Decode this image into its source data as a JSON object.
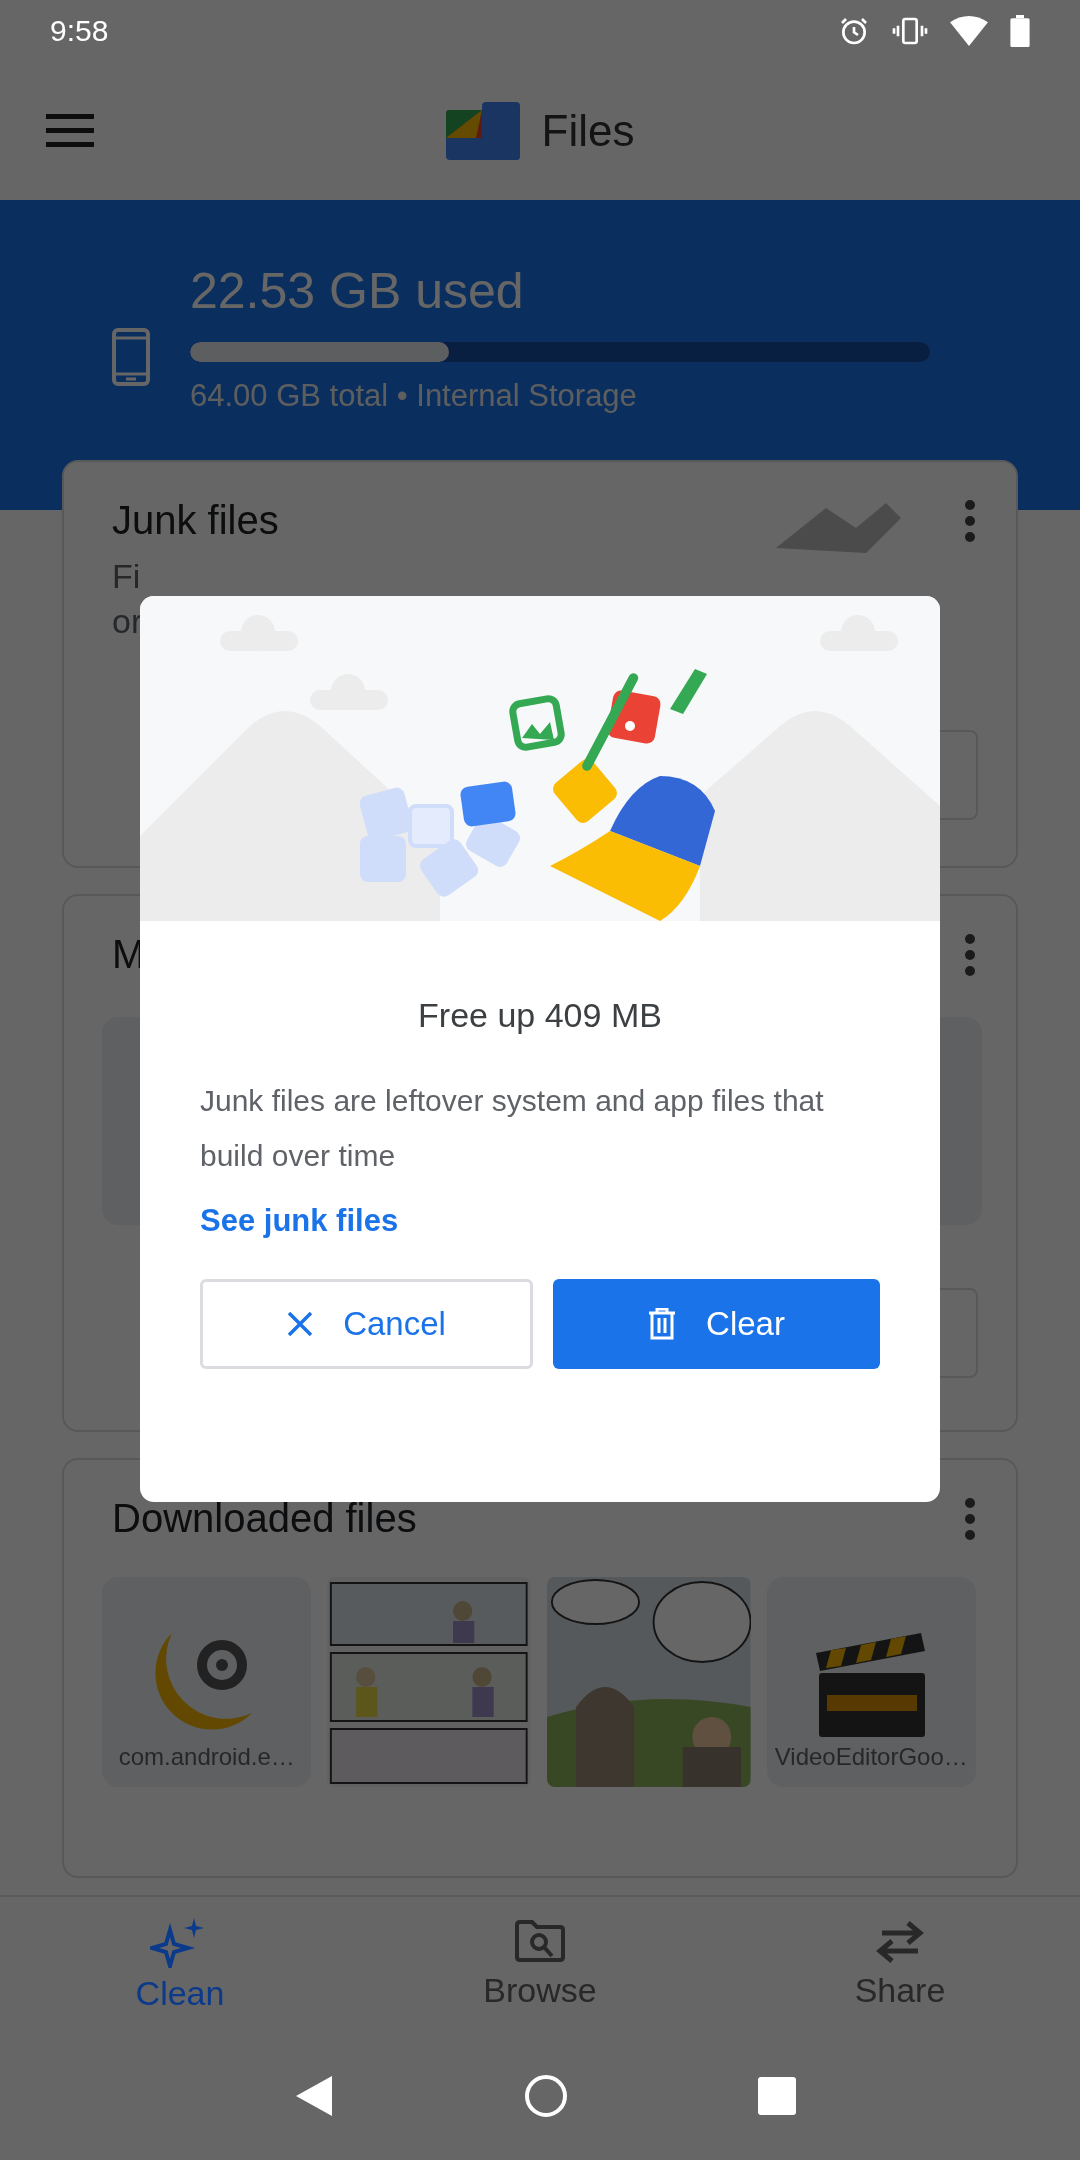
{
  "status_bar": {
    "time": "9:58"
  },
  "app_bar": {
    "title": "Files"
  },
  "storage": {
    "used": "22.53 GB used",
    "level": 0.35,
    "detail": "64.00 GB total • Internal Storage"
  },
  "cards": [
    {
      "kind": "junk",
      "title": "Junk files",
      "lines": [
        "Fi",
        "or"
      ]
    },
    {
      "kind": "media",
      "title": "M"
    },
    {
      "kind": "downloads",
      "title": "Downloaded files",
      "files": [
        {
          "kind": "app",
          "name": "com.android.e…"
        },
        {
          "kind": "picture"
        },
        {
          "kind": "picture"
        },
        {
          "kind": "video",
          "name": "VideoEditorGoo…"
        }
      ]
    }
  ],
  "dialog": {
    "title": "Free up 409 MB",
    "body": "Junk files are leftover system and app files that build over time",
    "link": "See junk files",
    "buttons": [
      {
        "kind": "cancel",
        "label": "Cancel"
      },
      {
        "kind": "confirm",
        "label": "Clear"
      }
    ]
  },
  "bottom_nav": [
    {
      "label": "Clean",
      "selected": true
    },
    {
      "label": "Browse",
      "selected": false
    },
    {
      "label": "Share",
      "selected": false
    }
  ]
}
